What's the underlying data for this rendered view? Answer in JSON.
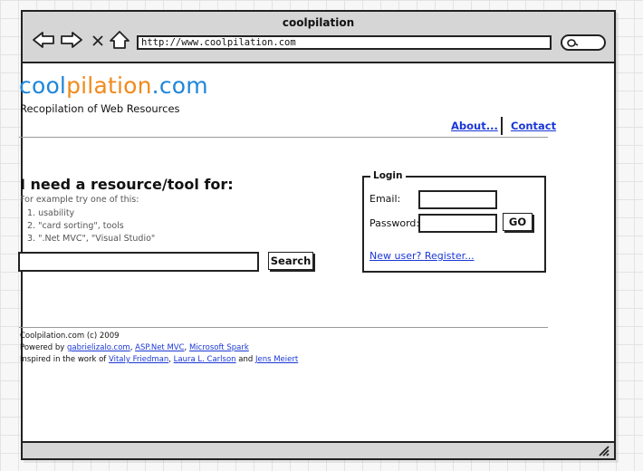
{
  "browser": {
    "title": "coolpilation",
    "address": "http://www.coolpilation.com",
    "nav_icons": [
      "back-icon",
      "forward-icon",
      "stop-icon",
      "home-icon"
    ],
    "search_icon": "search-icon"
  },
  "header": {
    "logo": {
      "part1": "cool",
      "part2": "pilation",
      "part3": ".com"
    },
    "tagline": "Recopilation of Web Resources",
    "links": {
      "about": "About...",
      "contact": "Contact"
    }
  },
  "search": {
    "heading": "I need a resource/tool for:",
    "hint": "For example try one of this:",
    "examples": [
      "1. usability",
      "2. \"card sorting\", tools",
      "3. \".Net MVC\", \"Visual Studio\""
    ],
    "input_value": "",
    "button": "Search"
  },
  "login": {
    "legend": "Login",
    "email_label": "Email:",
    "password_label": "Password:",
    "go_button": "GO",
    "register_link": "New user? Register..."
  },
  "footer": {
    "copyright": "Coolpilation.com (c) 2009",
    "powered_prefix": "Powered by",
    "powered_links": [
      "gabrielizalo.com",
      "ASP.Net MVC",
      "Microsoft Spark"
    ],
    "inspired_prefix": "Inspired in the work of",
    "inspired_links": [
      "Vitaly Friedman",
      "Laura L. Carlson",
      "Jens Meiert"
    ],
    "inspired_and": "and"
  },
  "colors": {
    "logo_blue": "#1f86d9",
    "logo_orange": "#f08a1c",
    "link": "#1a37d6"
  }
}
